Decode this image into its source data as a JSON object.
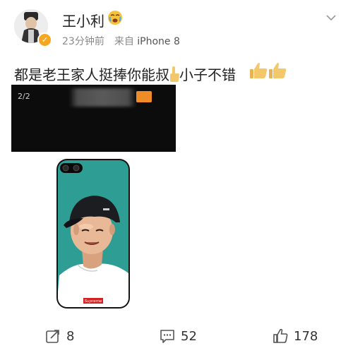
{
  "post": {
    "author": "王小利",
    "time": "23分钟前",
    "source_prefix": "来自",
    "device": "iPhone 8",
    "text_part1": "都是老王家人挺捧你能叔",
    "text_part2": "小子不错"
  },
  "image_viewer": {
    "counter": "2/2"
  },
  "phone_case": {
    "brand_label": "Supreme"
  },
  "actions": {
    "repost_count": "8",
    "comment_count": "52",
    "like_count": "178"
  },
  "colors": {
    "verified_badge": "#f5a623",
    "case_background": "#2e9e95",
    "brand_red": "#d32020",
    "action_icon": "#555555"
  },
  "icons": {
    "verified": "verified-badge-icon",
    "repost": "repost-icon",
    "comment": "comment-icon",
    "like": "like-icon",
    "more": "chevron-down-icon"
  }
}
